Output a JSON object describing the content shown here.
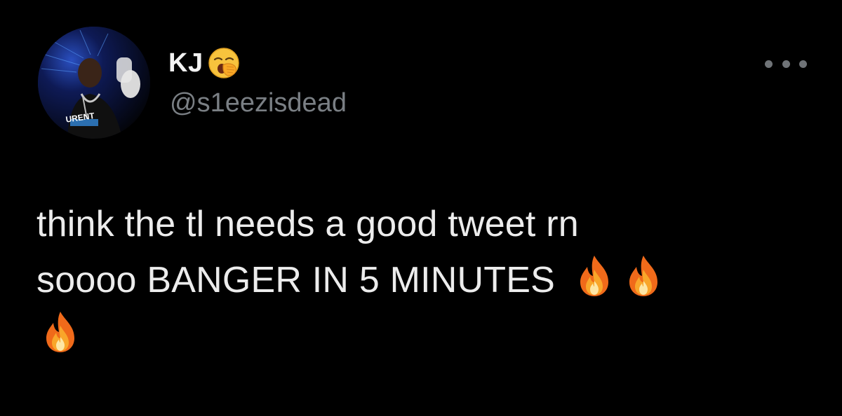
{
  "tweet": {
    "author": {
      "display_name": "KJ",
      "name_emoji": "yawning-face-emoji",
      "handle": "@s1eezisdead",
      "avatar_text": "URENT"
    },
    "more_icon": "more-horizontal-icon",
    "text_lines": [
      "think the tl needs a good tweet rn",
      "soooo BANGER IN 5 MINUTES"
    ],
    "fire_emoji": "fire-emoji",
    "fire_count": 3
  },
  "colors": {
    "background": "#000000",
    "text_primary": "#ececec",
    "text_secondary": "#7a7f84"
  }
}
